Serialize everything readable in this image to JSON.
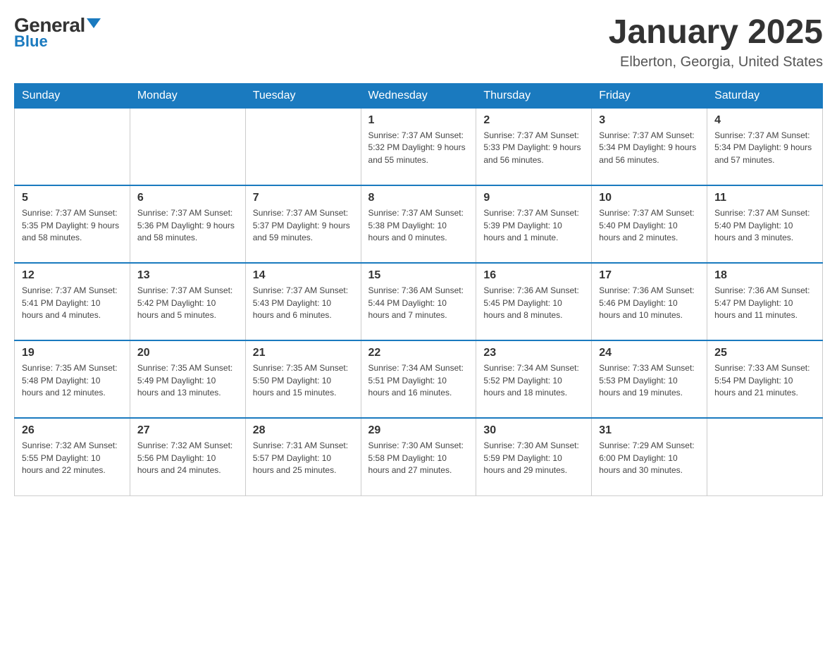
{
  "logo": {
    "general": "General",
    "blue": "Blue"
  },
  "title": "January 2025",
  "subtitle": "Elberton, Georgia, United States",
  "headers": [
    "Sunday",
    "Monday",
    "Tuesday",
    "Wednesday",
    "Thursday",
    "Friday",
    "Saturday"
  ],
  "weeks": [
    [
      {
        "num": "",
        "info": ""
      },
      {
        "num": "",
        "info": ""
      },
      {
        "num": "",
        "info": ""
      },
      {
        "num": "1",
        "info": "Sunrise: 7:37 AM\nSunset: 5:32 PM\nDaylight: 9 hours\nand 55 minutes."
      },
      {
        "num": "2",
        "info": "Sunrise: 7:37 AM\nSunset: 5:33 PM\nDaylight: 9 hours\nand 56 minutes."
      },
      {
        "num": "3",
        "info": "Sunrise: 7:37 AM\nSunset: 5:34 PM\nDaylight: 9 hours\nand 56 minutes."
      },
      {
        "num": "4",
        "info": "Sunrise: 7:37 AM\nSunset: 5:34 PM\nDaylight: 9 hours\nand 57 minutes."
      }
    ],
    [
      {
        "num": "5",
        "info": "Sunrise: 7:37 AM\nSunset: 5:35 PM\nDaylight: 9 hours\nand 58 minutes."
      },
      {
        "num": "6",
        "info": "Sunrise: 7:37 AM\nSunset: 5:36 PM\nDaylight: 9 hours\nand 58 minutes."
      },
      {
        "num": "7",
        "info": "Sunrise: 7:37 AM\nSunset: 5:37 PM\nDaylight: 9 hours\nand 59 minutes."
      },
      {
        "num": "8",
        "info": "Sunrise: 7:37 AM\nSunset: 5:38 PM\nDaylight: 10 hours\nand 0 minutes."
      },
      {
        "num": "9",
        "info": "Sunrise: 7:37 AM\nSunset: 5:39 PM\nDaylight: 10 hours\nand 1 minute."
      },
      {
        "num": "10",
        "info": "Sunrise: 7:37 AM\nSunset: 5:40 PM\nDaylight: 10 hours\nand 2 minutes."
      },
      {
        "num": "11",
        "info": "Sunrise: 7:37 AM\nSunset: 5:40 PM\nDaylight: 10 hours\nand 3 minutes."
      }
    ],
    [
      {
        "num": "12",
        "info": "Sunrise: 7:37 AM\nSunset: 5:41 PM\nDaylight: 10 hours\nand 4 minutes."
      },
      {
        "num": "13",
        "info": "Sunrise: 7:37 AM\nSunset: 5:42 PM\nDaylight: 10 hours\nand 5 minutes."
      },
      {
        "num": "14",
        "info": "Sunrise: 7:37 AM\nSunset: 5:43 PM\nDaylight: 10 hours\nand 6 minutes."
      },
      {
        "num": "15",
        "info": "Sunrise: 7:36 AM\nSunset: 5:44 PM\nDaylight: 10 hours\nand 7 minutes."
      },
      {
        "num": "16",
        "info": "Sunrise: 7:36 AM\nSunset: 5:45 PM\nDaylight: 10 hours\nand 8 minutes."
      },
      {
        "num": "17",
        "info": "Sunrise: 7:36 AM\nSunset: 5:46 PM\nDaylight: 10 hours\nand 10 minutes."
      },
      {
        "num": "18",
        "info": "Sunrise: 7:36 AM\nSunset: 5:47 PM\nDaylight: 10 hours\nand 11 minutes."
      }
    ],
    [
      {
        "num": "19",
        "info": "Sunrise: 7:35 AM\nSunset: 5:48 PM\nDaylight: 10 hours\nand 12 minutes."
      },
      {
        "num": "20",
        "info": "Sunrise: 7:35 AM\nSunset: 5:49 PM\nDaylight: 10 hours\nand 13 minutes."
      },
      {
        "num": "21",
        "info": "Sunrise: 7:35 AM\nSunset: 5:50 PM\nDaylight: 10 hours\nand 15 minutes."
      },
      {
        "num": "22",
        "info": "Sunrise: 7:34 AM\nSunset: 5:51 PM\nDaylight: 10 hours\nand 16 minutes."
      },
      {
        "num": "23",
        "info": "Sunrise: 7:34 AM\nSunset: 5:52 PM\nDaylight: 10 hours\nand 18 minutes."
      },
      {
        "num": "24",
        "info": "Sunrise: 7:33 AM\nSunset: 5:53 PM\nDaylight: 10 hours\nand 19 minutes."
      },
      {
        "num": "25",
        "info": "Sunrise: 7:33 AM\nSunset: 5:54 PM\nDaylight: 10 hours\nand 21 minutes."
      }
    ],
    [
      {
        "num": "26",
        "info": "Sunrise: 7:32 AM\nSunset: 5:55 PM\nDaylight: 10 hours\nand 22 minutes."
      },
      {
        "num": "27",
        "info": "Sunrise: 7:32 AM\nSunset: 5:56 PM\nDaylight: 10 hours\nand 24 minutes."
      },
      {
        "num": "28",
        "info": "Sunrise: 7:31 AM\nSunset: 5:57 PM\nDaylight: 10 hours\nand 25 minutes."
      },
      {
        "num": "29",
        "info": "Sunrise: 7:30 AM\nSunset: 5:58 PM\nDaylight: 10 hours\nand 27 minutes."
      },
      {
        "num": "30",
        "info": "Sunrise: 7:30 AM\nSunset: 5:59 PM\nDaylight: 10 hours\nand 29 minutes."
      },
      {
        "num": "31",
        "info": "Sunrise: 7:29 AM\nSunset: 6:00 PM\nDaylight: 10 hours\nand 30 minutes."
      },
      {
        "num": "",
        "info": ""
      }
    ]
  ]
}
